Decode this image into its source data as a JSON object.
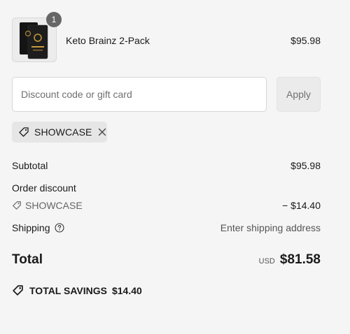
{
  "order": {
    "item": {
      "name": "Keto Brainz 2-Pack",
      "price": "$95.98",
      "quantity": "1"
    }
  },
  "discount": {
    "placeholder": "Discount code or gift card",
    "value": "",
    "apply_label": "Apply",
    "applied_code": "SHOWCASE"
  },
  "summary": {
    "subtotal_label": "Subtotal",
    "subtotal_value": "$95.98",
    "order_discount_label": "Order discount",
    "discount_code": "SHOWCASE",
    "discount_value": "− $14.40",
    "shipping_label": "Shipping",
    "shipping_value": "Enter shipping address",
    "total_label": "Total",
    "currency": "USD",
    "total_value": "$81.58",
    "savings_label": "TOTAL SAVINGS",
    "savings_value": "$14.40"
  },
  "icons": {
    "tag": "tag-icon",
    "close": "close-icon",
    "info": "question-circle-icon",
    "savings": "savings-tag-icon"
  },
  "colors": {
    "background": "#f5f5f5",
    "badge": "#666666",
    "muted_text": "#707070"
  }
}
